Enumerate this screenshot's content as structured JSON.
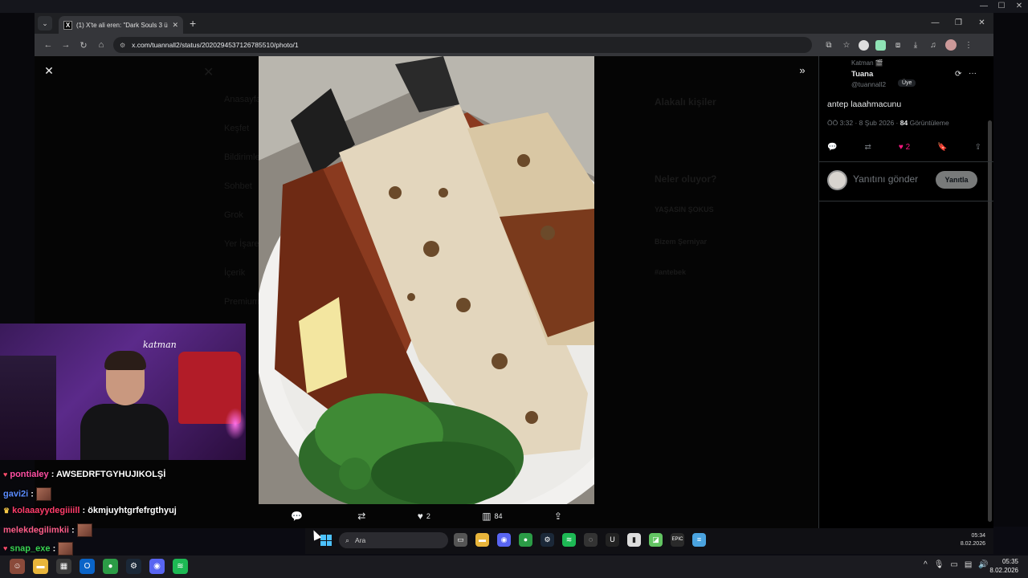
{
  "browser": {
    "tab_title": "(1) X'te ali eren: \"Dark Souls 3 ü",
    "url": "x.com/tuannall2/status/2020294537126785510/photo/1"
  },
  "viewer": {
    "actions": {
      "reply_count": "",
      "like_count": "2",
      "view_count": "84"
    }
  },
  "background_ghost": {
    "nav": [
      "Anasayfa",
      "Keşfet",
      "Bildirimler",
      "Sohbet",
      "Grok",
      "Yer İşaretleri",
      "İçerik",
      "Premium"
    ],
    "suggest_title": "Alakalı kişiler",
    "trends_title": "Neler oluyor?",
    "trend_items": [
      "YAŞASIN ŞOKUS",
      "Bizem Şerniyar",
      "#antebek"
    ]
  },
  "tweet": {
    "reposted_by": "Katman 🎬",
    "name": "Tuana",
    "handle": "@tuannall2",
    "badge": "Üye",
    "text": "antep laaahmacunu",
    "time": "ÖÖ 3:32 · 8 Şub 2026 ·",
    "views_num": "84",
    "views_label": "Görüntüleme",
    "like_count": "2",
    "reply_placeholder": "Yanıtını gönder",
    "reply_button": "Yanıtla"
  },
  "webcam": {
    "sign": "katman"
  },
  "chat": [
    {
      "user": "",
      "text": "",
      "user_color": "#ffffff"
    },
    {
      "user": "pontialey",
      "text": ": AWSEDRFTGYHUJIKOLŞİ",
      "user_color": "#ff4fa3"
    },
    {
      "user": "gavi2i",
      "text": ":",
      "user_color": "#5b8cff"
    },
    {
      "user": "kolaaayydegiiiill",
      "text": ": ökmjuyhtgrfefrgthyuj",
      "user_color": "#ff3d6a"
    },
    {
      "user": "melekdegilimkii",
      "text": ":",
      "user_color": "#ff5e8a"
    },
    {
      "user": "snap_exe",
      "text": ":",
      "user_color": "#39d353"
    }
  ],
  "inner_taskbar": {
    "search_placeholder": "Ara",
    "time": "05:34",
    "date": "8.02.2026"
  },
  "outer_taskbar": {
    "time": "05:35",
    "date": "8.02.2026"
  }
}
